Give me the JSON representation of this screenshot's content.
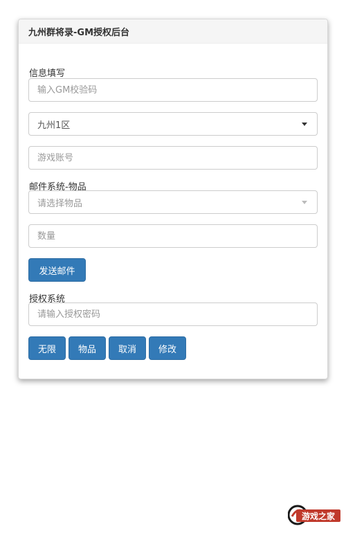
{
  "panel": {
    "title": "九州群将录-GM授权后台"
  },
  "info_section": {
    "label": "信息填写",
    "gm_code_placeholder": "输入GM校验码",
    "server_select_value": "九州1区",
    "account_placeholder": "游戏账号"
  },
  "mail_section": {
    "label": "邮件系统-物品",
    "item_select_placeholder": "请选择物品",
    "quantity_placeholder": "数量",
    "send_button": "发送邮件"
  },
  "auth_section": {
    "label": "授权系统",
    "password_placeholder": "请输入授权密码",
    "buttons": {
      "unlimited": "无限",
      "items": "物品",
      "cancel": "取消",
      "modify": "修改"
    }
  },
  "watermark": {
    "text": "游戏之家"
  },
  "colors": {
    "primary_button": "#337ab7",
    "panel_heading_bg": "#f5f5f5",
    "input_border": "#cccccc"
  }
}
